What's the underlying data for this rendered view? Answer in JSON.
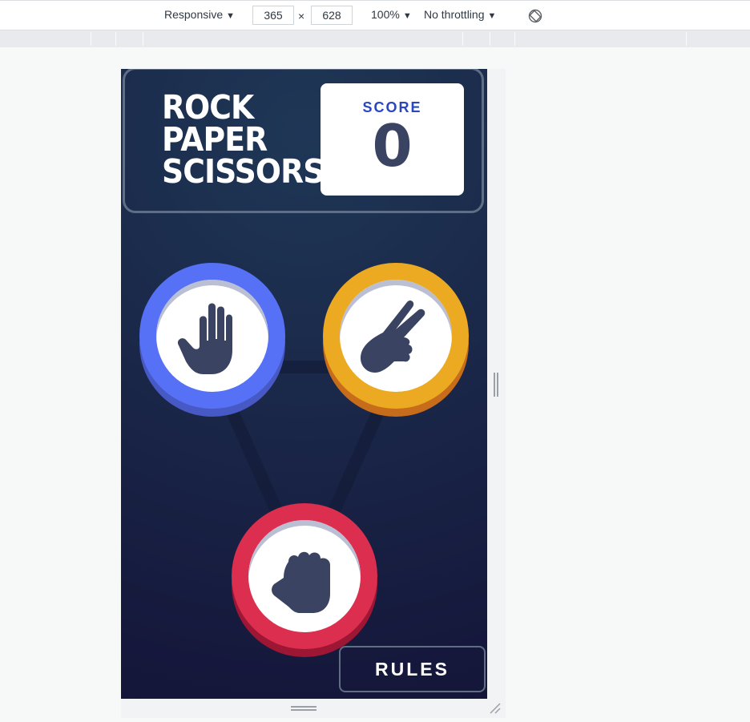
{
  "devtools": {
    "device_mode": "Responsive",
    "width": "365",
    "times": "×",
    "height": "628",
    "zoom": "100%",
    "throttling": "No throttling",
    "rotate_icon": "rotate-icon"
  },
  "game": {
    "title_lines": [
      "ROCK",
      "PAPER",
      "SCISSORS"
    ],
    "score_label": "SCORE",
    "score_value": "0",
    "choices": [
      {
        "name": "paper",
        "color": "#5671f5",
        "icon": "paper-hand-icon"
      },
      {
        "name": "scissors",
        "color": "#eca922",
        "icon": "scissors-hand-icon"
      },
      {
        "name": "rock",
        "color": "#dc2e4e",
        "icon": "rock-fist-icon"
      }
    ],
    "rules_label": "RULES"
  },
  "colors": {
    "background_dark": "#141539",
    "background_light": "#1f3756",
    "header_outline": "#606e85",
    "score_text": "#2a46c0",
    "dark_text": "#3b4363"
  }
}
